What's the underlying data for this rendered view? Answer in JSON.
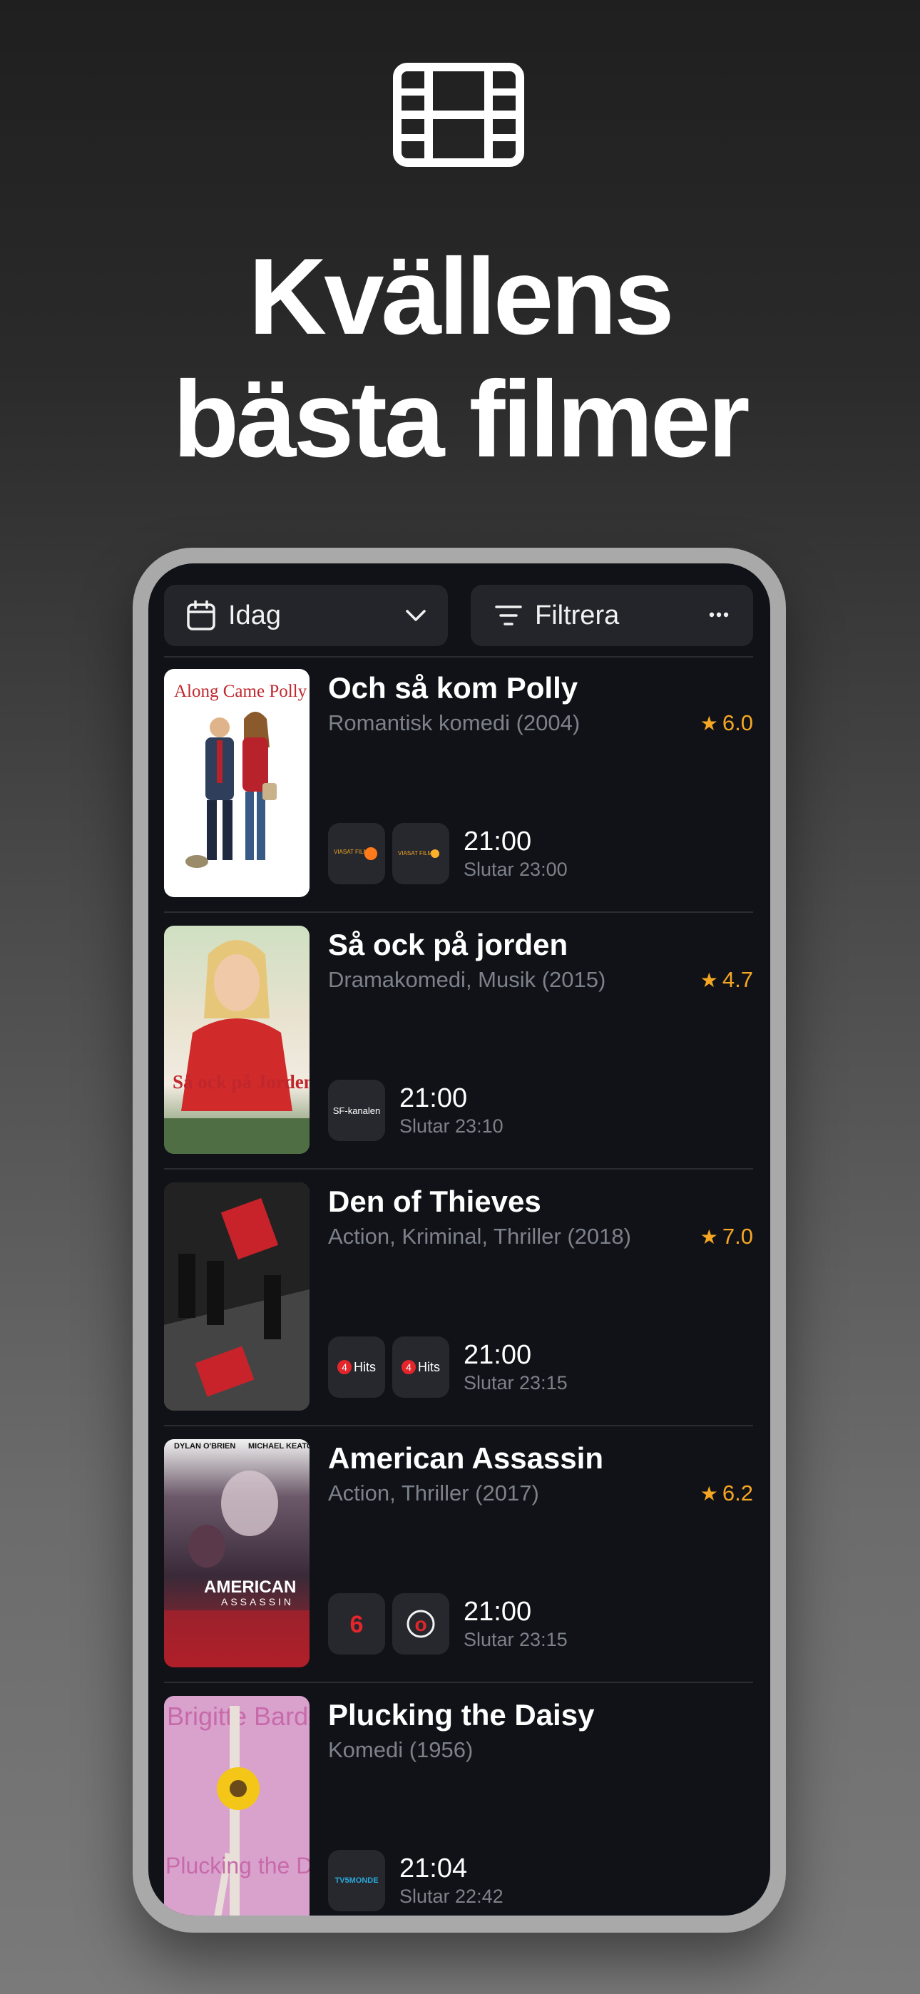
{
  "headline": {
    "line1": "Kvällens",
    "line2": "bästa filmer"
  },
  "toolbar": {
    "date_label": "Idag",
    "filter_label": "Filtrera"
  },
  "movies": [
    {
      "title": "Och så kom Polly",
      "meta": "Romantisk komedi (2004)",
      "rating": "6.0",
      "poster_text": "Along Came Polly",
      "channels": [
        "VIASAT FILM",
        "VIASAT FILM"
      ],
      "time": "21:00",
      "ends": "Slutar 23:00"
    },
    {
      "title": "Så ock på jorden",
      "meta": "Dramakomedi, Musik (2015)",
      "rating": "4.7",
      "poster_text": "Så ock på Jorden",
      "channels": [
        "SF-kanalen"
      ],
      "time": "21:00",
      "ends": "Slutar 23:10"
    },
    {
      "title": "Den of Thieves",
      "meta": "Action, Kriminal, Thriller (2018)",
      "rating": "7.0",
      "poster_text": "",
      "channels": [
        "Hits",
        "Hits"
      ],
      "time": "21:00",
      "ends": "Slutar 23:15"
    },
    {
      "title": "American Assassin",
      "meta": "Action, Thriller (2017)",
      "rating": "6.2",
      "poster_text": "AMERICAN",
      "poster_text2": "ASSASSIN",
      "poster_credit1": "DYLAN O'BRIEN",
      "poster_credit2": "MICHAEL KEATON",
      "channels": [
        "6",
        "o"
      ],
      "time": "21:00",
      "ends": "Slutar 23:15"
    },
    {
      "title": "Plucking the Daisy",
      "meta": "Komedi (1956)",
      "rating": "",
      "poster_text": "Plucking the Daisy",
      "poster_text2": "Brigitte Bardot",
      "channels": [
        "TV5MONDE"
      ],
      "time": "21:04",
      "ends": "Slutar 22:42"
    }
  ],
  "colors": {
    "accent": "#f5a623",
    "background": "#101217",
    "muted": "#7d818a"
  }
}
